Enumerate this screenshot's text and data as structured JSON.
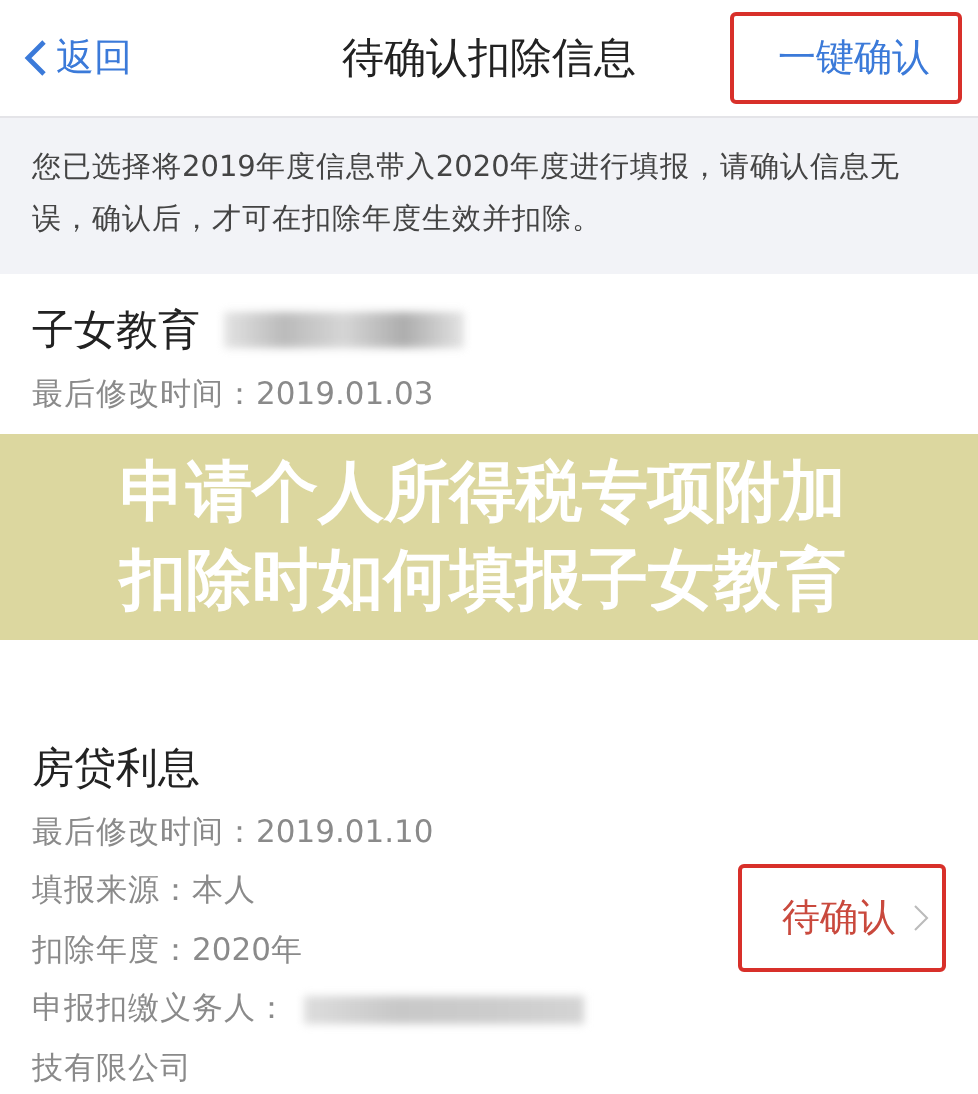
{
  "nav": {
    "back_label": "返回",
    "title": "待确认扣除信息",
    "action": "一键确认",
    "action_highlighted": true
  },
  "notice": "您已选择将2019年度信息带入2020年度进行填报，请确认信息无误，确认后，才可在扣除年度生效并扣除。",
  "items": [
    {
      "title": "子女教育",
      "title_redacted": true,
      "lines": [
        {
          "text": "最后修改时间：2019.01.03"
        }
      ],
      "banner": {
        "lines": [
          "申请个人所得税专项附加",
          "扣除时如何填报子女教育"
        ]
      }
    },
    {
      "title": "房贷利息",
      "lines": [
        {
          "text": "最后修改时间：2019.01.10"
        },
        {
          "text": "填报来源：本人"
        },
        {
          "text": "扣除年度：2020年"
        },
        {
          "text": "申报扣缴义务人：",
          "redacted": true
        },
        {
          "text": "技有限公司"
        }
      ],
      "action": "待确认",
      "highlighted": true
    }
  ]
}
